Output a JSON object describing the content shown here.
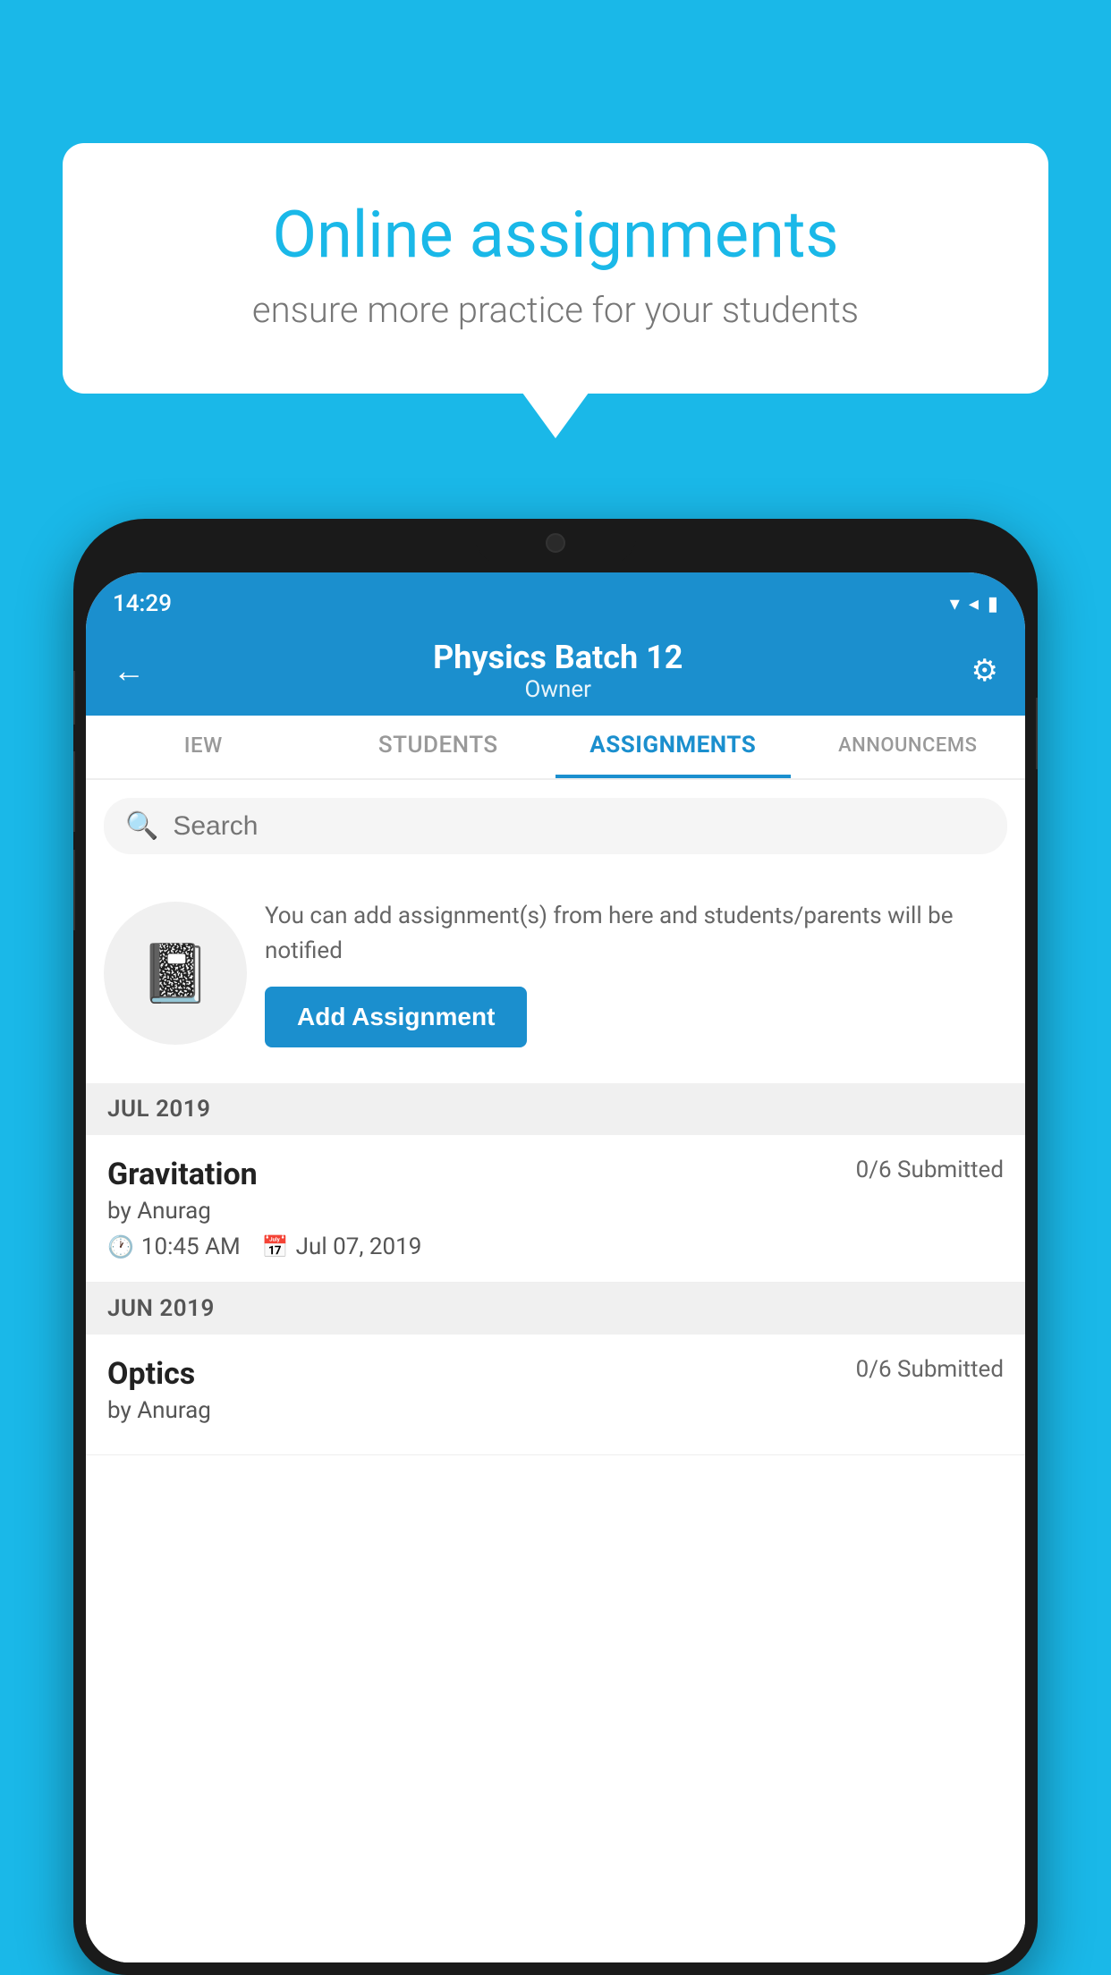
{
  "background_color": "#1ab8e8",
  "speech_bubble": {
    "title": "Online assignments",
    "subtitle": "ensure more practice for your students"
  },
  "phone": {
    "status_bar": {
      "time": "14:29",
      "icons": "▾◂▮"
    },
    "header": {
      "title": "Physics Batch 12",
      "subtitle": "Owner",
      "back_label": "←",
      "settings_label": "⚙"
    },
    "tabs": [
      {
        "label": "IEW",
        "active": false
      },
      {
        "label": "STUDENTS",
        "active": false
      },
      {
        "label": "ASSIGNMENTS",
        "active": true
      },
      {
        "label": "ANNOUNCEM…",
        "active": false
      }
    ],
    "search": {
      "placeholder": "Search"
    },
    "empty_state": {
      "description": "You can add assignment(s) from here and students/parents will be notified",
      "button_label": "Add Assignment"
    },
    "sections": [
      {
        "label": "JUL 2019",
        "assignments": [
          {
            "title": "Gravitation",
            "submitted": "0/6 Submitted",
            "author": "by Anurag",
            "time": "10:45 AM",
            "date": "Jul 07, 2019"
          }
        ]
      },
      {
        "label": "JUN 2019",
        "assignments": [
          {
            "title": "Optics",
            "submitted": "0/6 Submitted",
            "author": "by Anurag",
            "time": "",
            "date": ""
          }
        ]
      }
    ]
  }
}
